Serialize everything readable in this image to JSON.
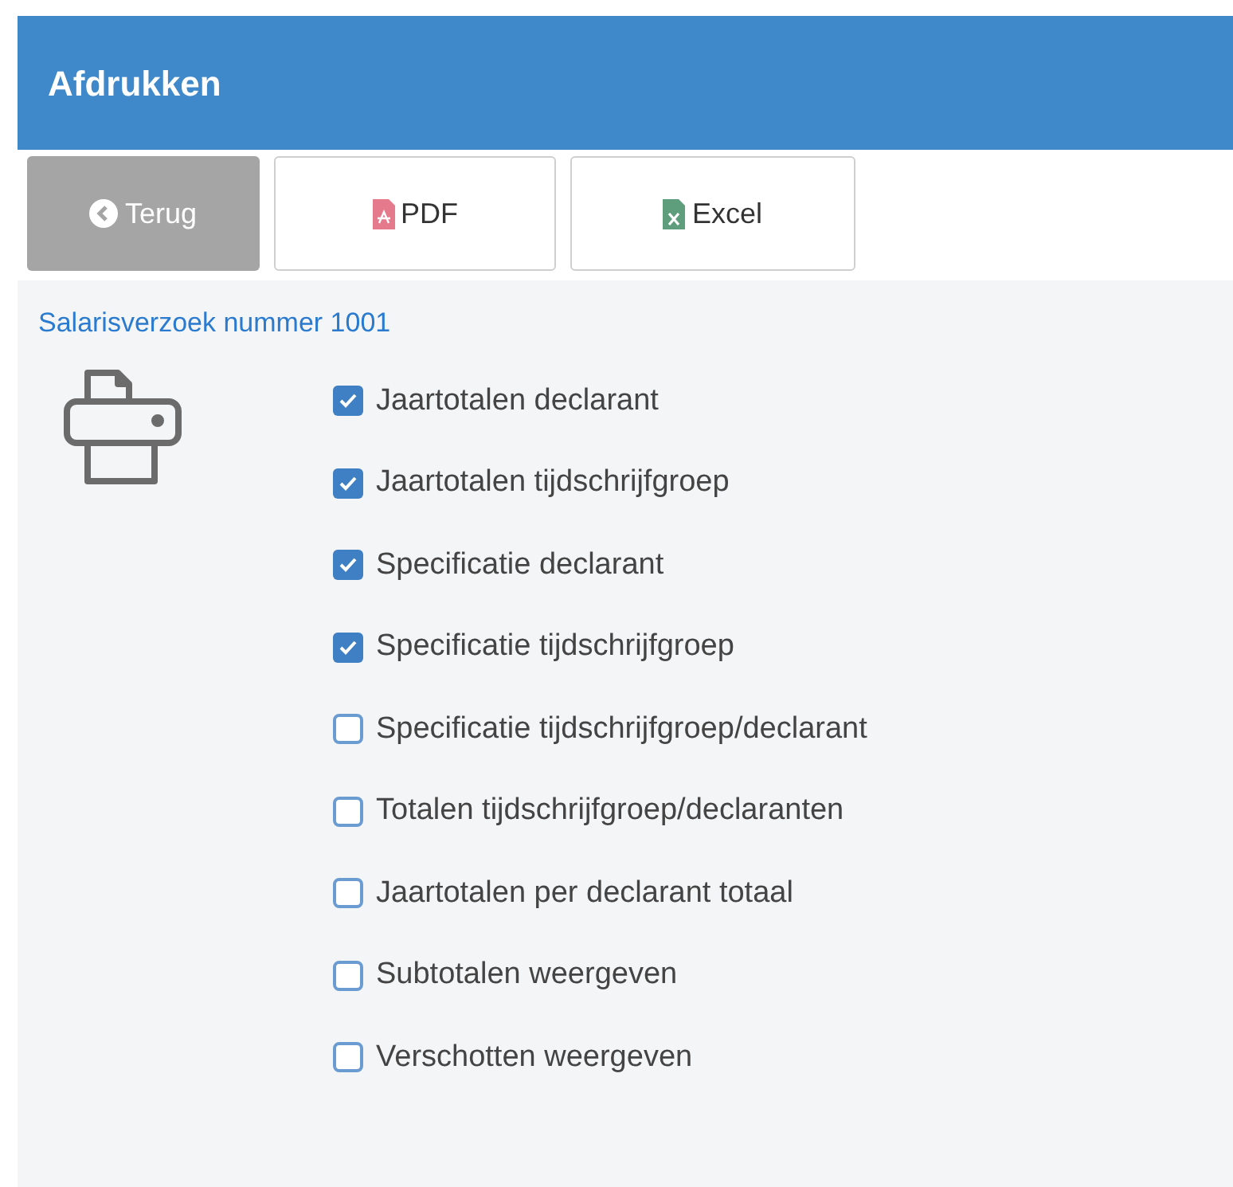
{
  "header": {
    "title": "Afdrukken"
  },
  "toolbar": [
    {
      "kind": "back",
      "label": "Terug"
    },
    {
      "kind": "pdf",
      "label": "PDF"
    },
    {
      "kind": "excel",
      "label": "Excel"
    }
  ],
  "link": "Salarisverzoek nummer 1001",
  "options": [
    {
      "label": "Jaartotalen declarant",
      "checked": true
    },
    {
      "label": "Jaartotalen tijdschrijfgroep",
      "checked": true
    },
    {
      "label": "Specificatie declarant",
      "checked": true
    },
    {
      "label": "Specificatie tijdschrijfgroep",
      "checked": true
    },
    {
      "label": "Specificatie tijdschrijfgroep/declarant",
      "checked": false
    },
    {
      "label": "Totalen tijdschrijfgroep/declaranten",
      "checked": false
    },
    {
      "label": "Jaartotalen per declarant totaal",
      "checked": false
    },
    {
      "label": "Subtotalen weergeven",
      "checked": false
    },
    {
      "label": "Verschotten weergeven",
      "checked": false
    }
  ]
}
